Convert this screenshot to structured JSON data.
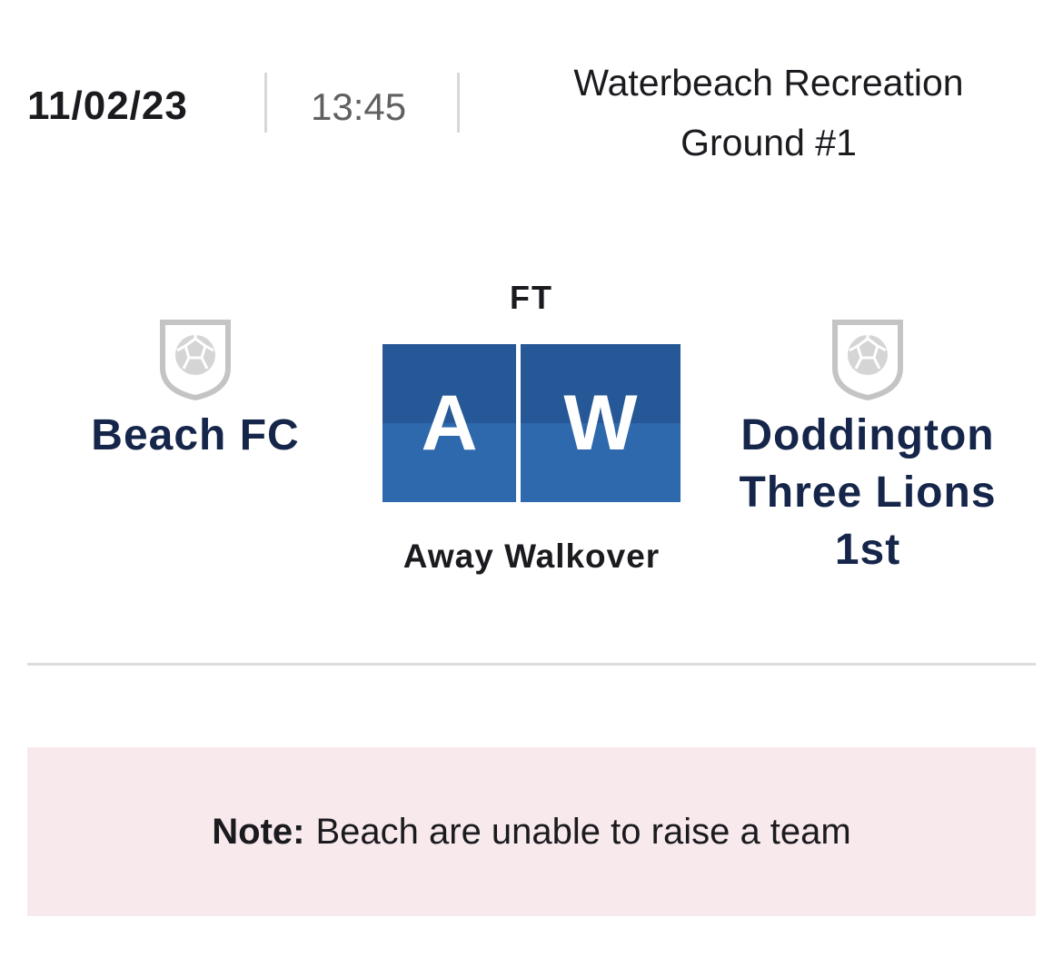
{
  "fixture": {
    "date": "11/02/23",
    "time": "13:45",
    "venue_line1": "Waterbeach Recreation",
    "venue_line2": "Ground #1"
  },
  "match": {
    "status": "FT",
    "home_team": {
      "name": "Beach FC",
      "crest_icon": "football-shield-icon"
    },
    "away_team": {
      "name_line1": "Doddington",
      "name_line2": "Three Lions",
      "name_line3": "1st",
      "crest_icon": "football-shield-icon"
    },
    "home_score": "A",
    "away_score": "W",
    "result_description": "Away Walkover"
  },
  "note": {
    "label": "Note:",
    "text": "Beach are unable to raise a team"
  },
  "colors": {
    "team_text": "#15264a",
    "score_dark": "#265796",
    "score_light": "#2e68ad",
    "note_bg": "#f8eaec"
  }
}
